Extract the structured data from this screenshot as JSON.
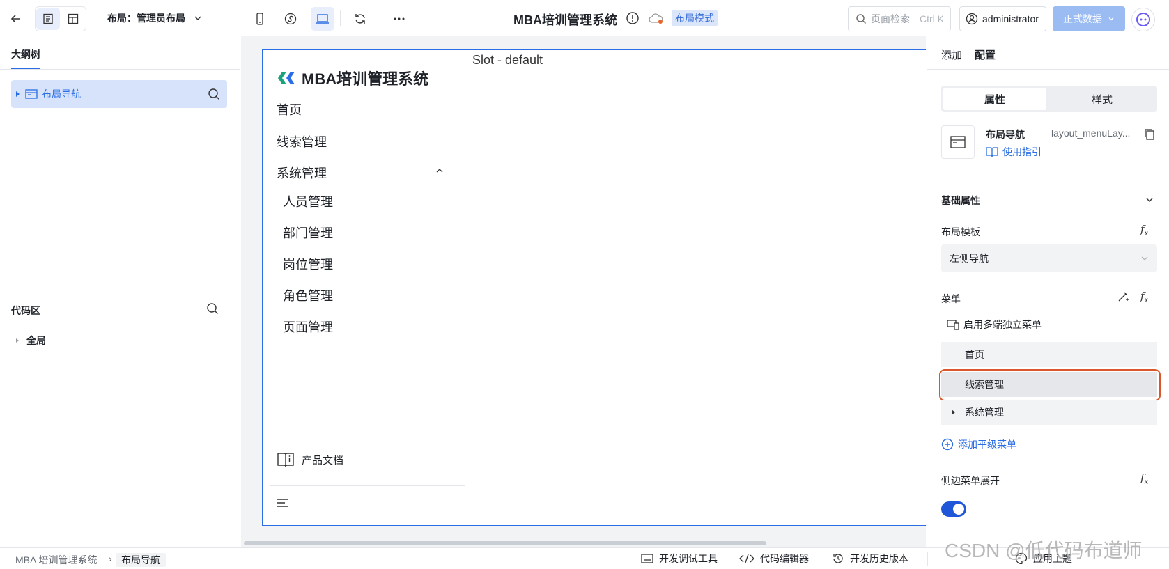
{
  "topbar": {
    "layout_label": "布局：管理员布局",
    "app_title": "MBA培训管理系统",
    "mode_badge": "布局模式",
    "search_placeholder": "页面检索",
    "search_shortcut": "Ctrl K",
    "user": "administrator",
    "data_button": "正式数据"
  },
  "left": {
    "tab": "大纲树",
    "outline_item": "布局导航",
    "code_title": "代码区",
    "global": "全局"
  },
  "preview": {
    "brand": "MBA培训管理系统",
    "nav": [
      "首页",
      "线索管理",
      "系统管理"
    ],
    "sub_nav": [
      "人员管理",
      "部门管理",
      "岗位管理",
      "角色管理",
      "页面管理"
    ],
    "doc_link": "产品文档",
    "slot": "Slot - default"
  },
  "right": {
    "tabs": [
      "添加",
      "配置"
    ],
    "segments": [
      "属性",
      "样式"
    ],
    "component_name": "布局导航",
    "component_id": "layout_menuLay...",
    "guide": "使用指引",
    "section": "基础属性",
    "layout_template_label": "布局模板",
    "layout_template_value": "左侧导航",
    "menu_label": "菜单",
    "multi_menu": "启用多端独立菜单",
    "menu_rows": [
      "首页",
      "线索管理",
      "系统管理"
    ],
    "add_menu": "添加平级菜单",
    "side_expand_label": "侧边菜单展开",
    "side_expand_on": true
  },
  "bottom": {
    "crumbs": [
      "MBA 培训管理系统",
      "布局导航"
    ],
    "tools": [
      "开发调试工具",
      "代码编辑器",
      "开发历史版本"
    ],
    "theme": "应用主题"
  },
  "watermark": "CSDN @低代码布道师"
}
